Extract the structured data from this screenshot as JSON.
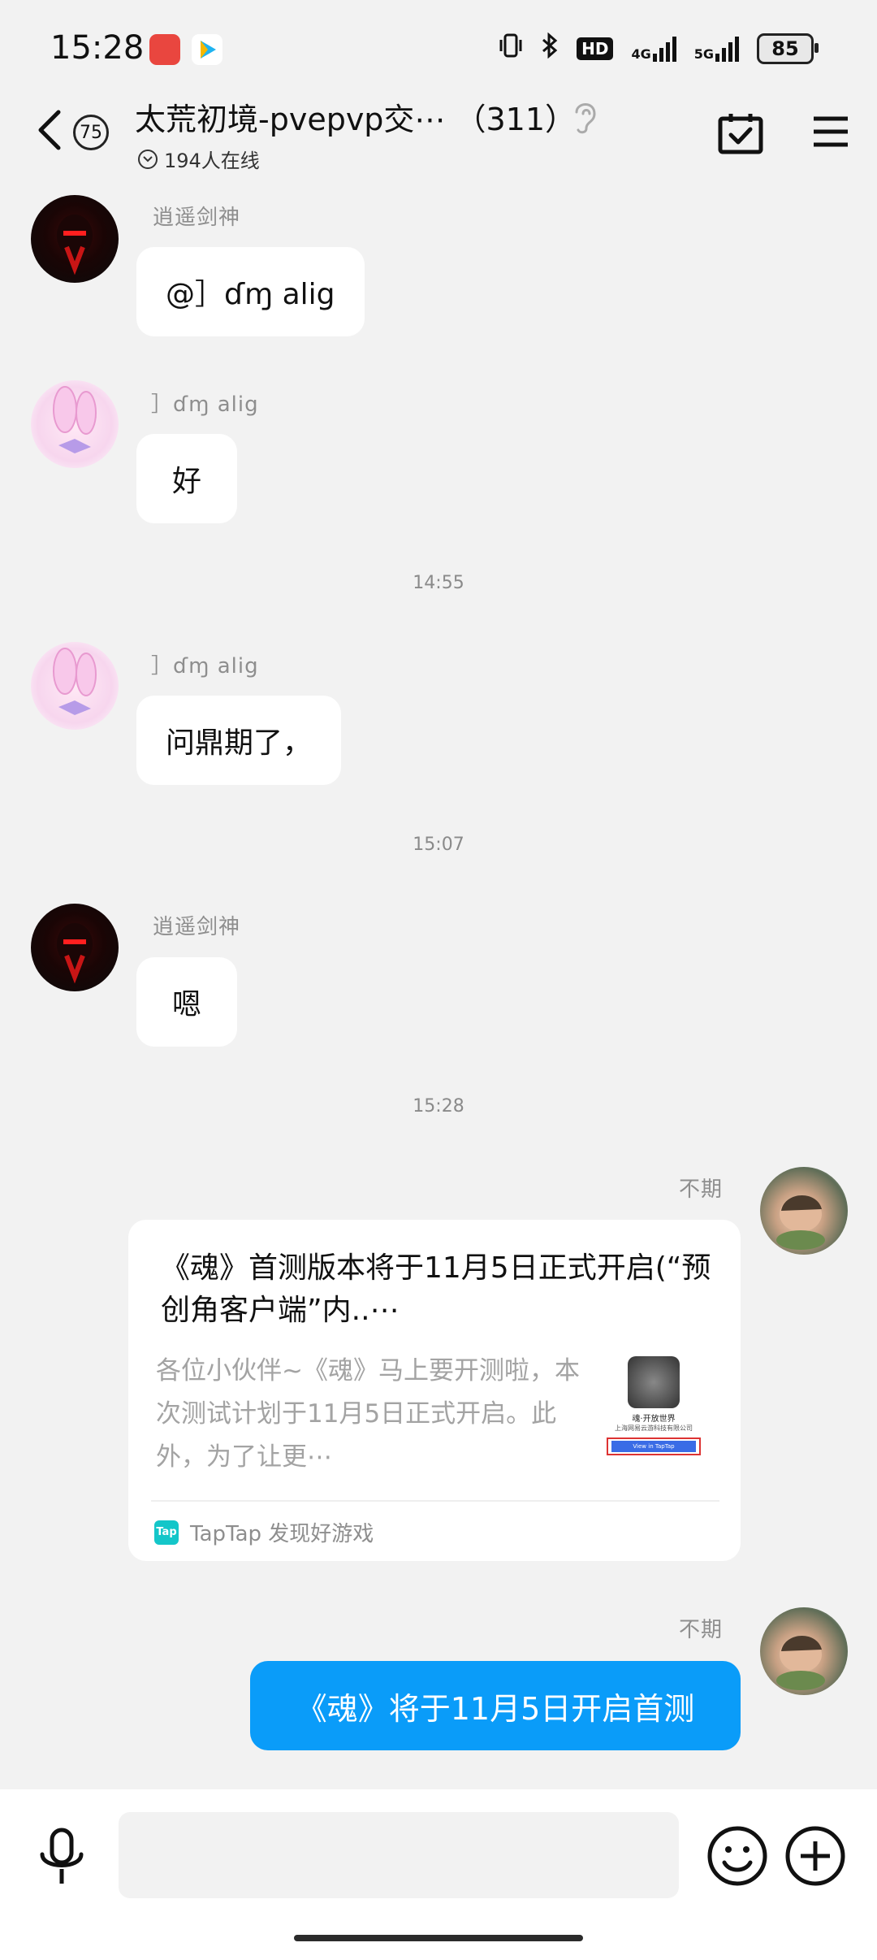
{
  "status_bar": {
    "time": "15:28",
    "battery": "85",
    "hd_label": "HD",
    "net_4g": "4G",
    "net_5g": "5G"
  },
  "header": {
    "unread_badge": "75",
    "title": "太荒初境-pvepvp交⋯ （311）",
    "online": "194人在线"
  },
  "messages": [
    {
      "sender": "逍遥剑神",
      "text": "@］ɗɱ alig"
    },
    {
      "sender": "］ɗɱ alig",
      "text": "好"
    },
    {
      "time": "14:55"
    },
    {
      "sender": "］ɗɱ alig",
      "text": "问鼎期了，"
    },
    {
      "time": "15:07"
    },
    {
      "sender": "逍遥剑神",
      "text": "嗯"
    },
    {
      "time": "15:28"
    },
    {
      "sender": "不期",
      "card": {
        "title": "《魂》首测版本将于11月5日正式开启(“预创角客户端”内..⋯",
        "description": "各位小伙伴~《魂》马上要开测啦，本次测试计划于11月5日正式开启。此外，为了让更⋯",
        "source": "TapTap 发现好游戏",
        "source_logo": "Tap",
        "thumb_text": "魂·开放世界",
        "thumb_company": "上海网易云游科技有限公司",
        "thumb_button": "View in TapTap"
      }
    },
    {
      "sender": "不期",
      "text": "《魂》将于11月5日开启首测"
    }
  ],
  "colors": {
    "accent": "#0a9cf9",
    "background": "#f2f2f2"
  }
}
